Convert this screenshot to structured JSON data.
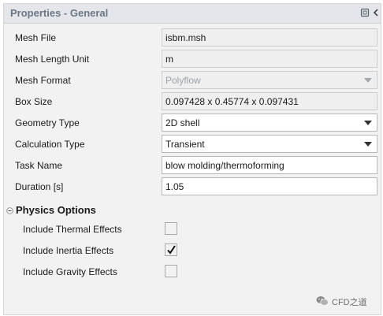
{
  "panel": {
    "title": "Properties - General",
    "restore_icon": "restore-window-icon",
    "back_icon": "chevron-left-icon"
  },
  "fields": {
    "mesh_file": {
      "label": "Mesh File",
      "value": "isbm.msh"
    },
    "mesh_length_unit": {
      "label": "Mesh Length Unit",
      "value": "m"
    },
    "mesh_format": {
      "label": "Mesh Format",
      "value": "Polyflow",
      "enabled": false
    },
    "box_size": {
      "label": "Box Size",
      "value": "0.097428 x 0.45774 x 0.097431"
    },
    "geometry_type": {
      "label": "Geometry Type",
      "value": "2D shell"
    },
    "calculation_type": {
      "label": "Calculation Type",
      "value": "Transient"
    },
    "task_name": {
      "label": "Task Name",
      "value": "blow molding/thermoforming"
    },
    "duration": {
      "label": "Duration [s]",
      "value": "1.05"
    }
  },
  "physics": {
    "title": "Physics Options",
    "collapse_icon": "collapse-minus-icon",
    "thermal": {
      "label": "Include Thermal Effects",
      "checked": false
    },
    "inertia": {
      "label": "Include Inertia Effects",
      "checked": true
    },
    "gravity": {
      "label": "Include Gravity Effects",
      "checked": false
    }
  },
  "watermark": {
    "text": "CFD之道",
    "icon": "wechat-icon"
  },
  "colors": {
    "title_text": "#6b7785",
    "panel_bg": "#f2f2f2",
    "titlebar_bg": "#e4e6e9"
  }
}
